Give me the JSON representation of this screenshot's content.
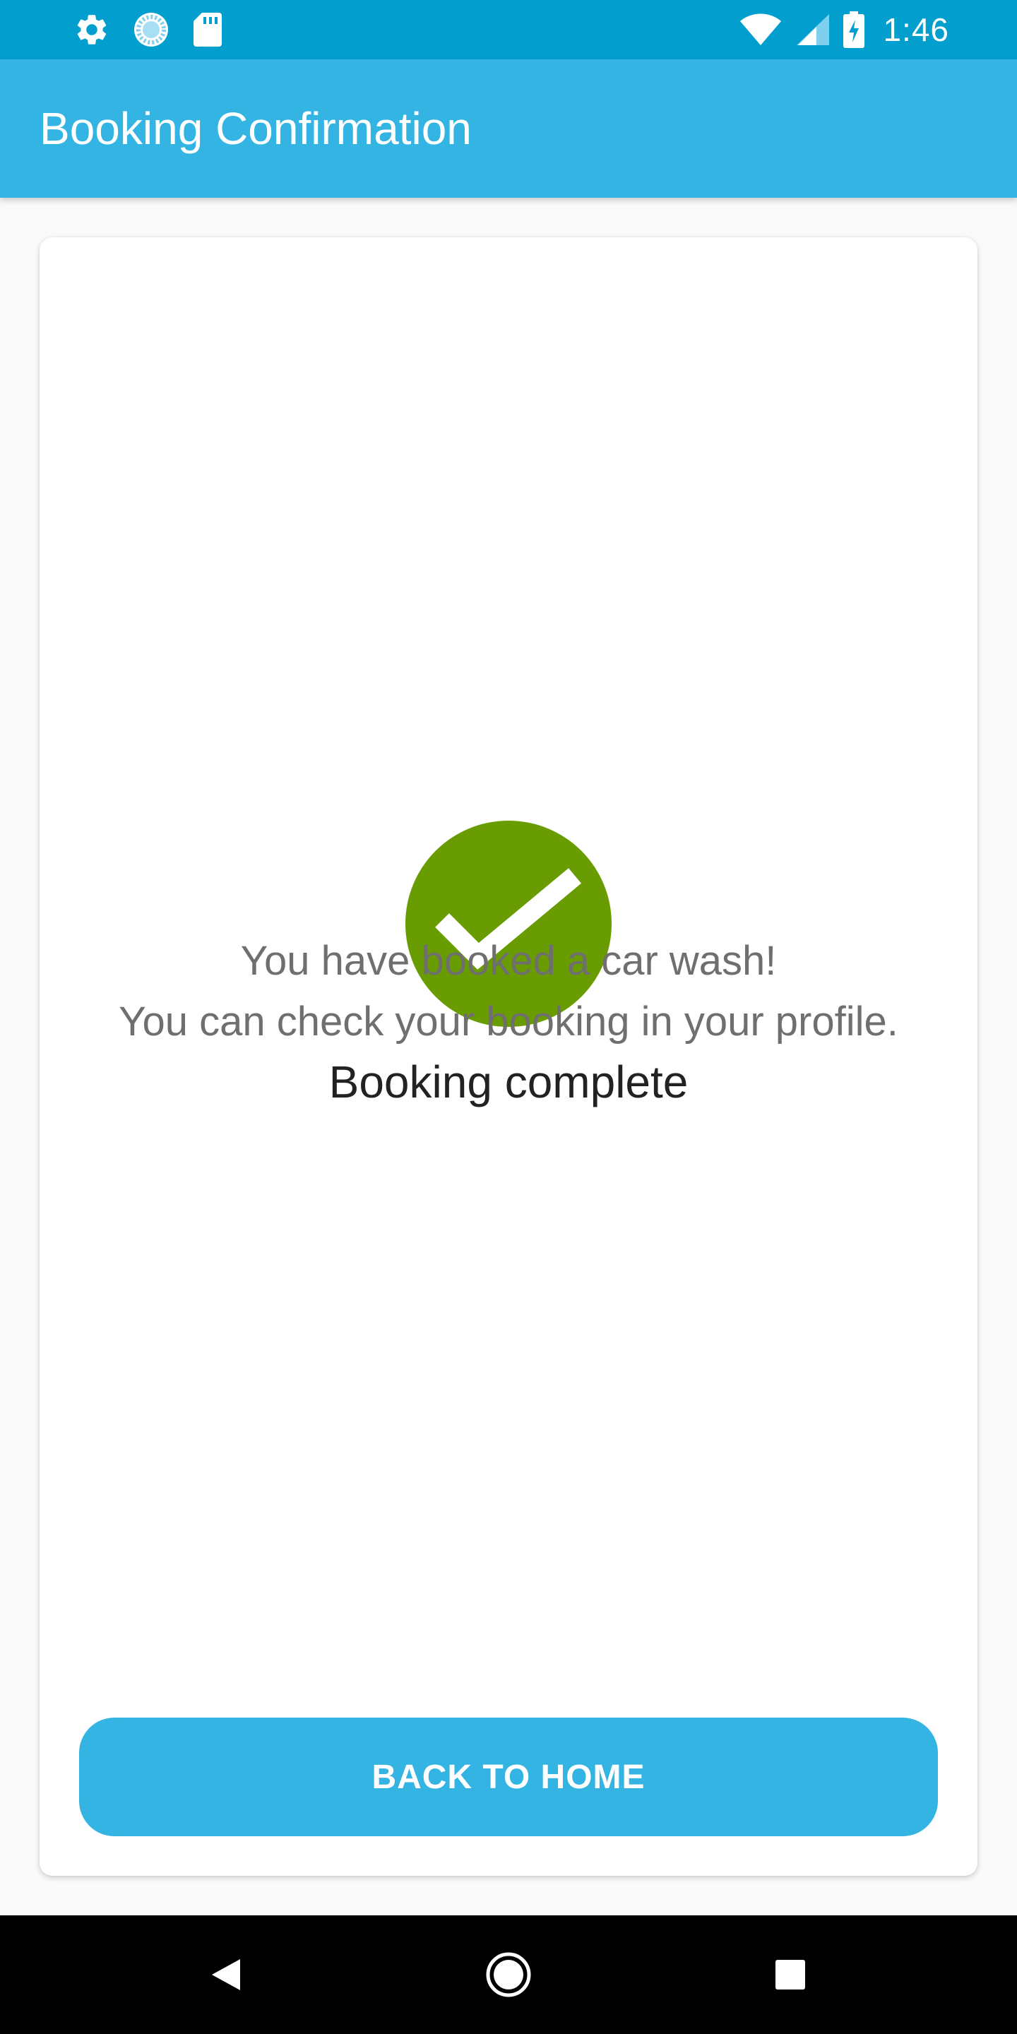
{
  "status_bar": {
    "time": "1:46",
    "icons": [
      "gear-icon",
      "sync-icon",
      "sd-card-icon",
      "wifi-icon",
      "signal-icon",
      "battery-charging-icon"
    ],
    "background": "#029ecd"
  },
  "app_bar": {
    "title": "Booking Confirmation",
    "background": "#34b4e3"
  },
  "confirmation": {
    "icon": "check-circle-icon",
    "icon_color": "#699c00",
    "title": "Booking complete",
    "message_line1": "You have booked a car wash!",
    "message_line2": "You can check your booking in your profile."
  },
  "actions": {
    "back_home_label": "BACK TO HOME",
    "button_color": "#34b4e3"
  },
  "nav_bar": {
    "buttons": [
      "back-icon",
      "home-icon",
      "recents-icon"
    ]
  }
}
